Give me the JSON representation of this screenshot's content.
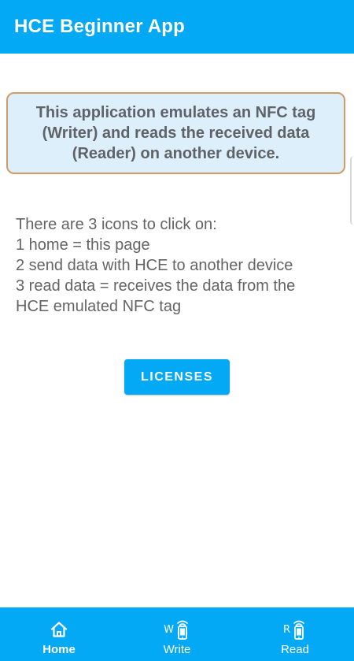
{
  "app": {
    "title": "HCE Beginner App",
    "accent_color": "#03A9F4"
  },
  "intro": {
    "text": "This application emulates an NFC tag (Writer) and reads the received data (Reader) on another device."
  },
  "instructions": {
    "lines": [
      "There are 3 icons to click on:",
      "1 home = this page",
      "2 send data with HCE to another device",
      "3 read data = receives the data from the",
      "HCE emulated NFC tag"
    ]
  },
  "licenses_button": {
    "label": "LICENSES"
  },
  "bottom_nav": {
    "active": "Home",
    "items": [
      {
        "label": "Home",
        "icon": "home-icon"
      },
      {
        "label": "Write",
        "icon": "phone-nfc-write-icon",
        "icon_letter": "W"
      },
      {
        "label": "Read",
        "icon": "phone-nfc-read-icon",
        "icon_letter": "R"
      }
    ]
  }
}
